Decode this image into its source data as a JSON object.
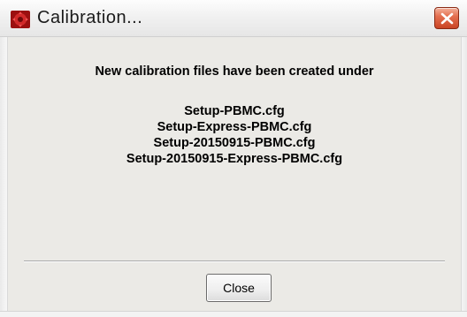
{
  "window": {
    "title": "Calibration...",
    "icon": "red-gear-icon",
    "close_icon": "close-x-icon",
    "accent_close": "#d9583a"
  },
  "dialog": {
    "message": "New calibration files have been created under",
    "files": [
      "Setup-PBMC.cfg",
      "Setup-Express-PBMC.cfg",
      "Setup-20150915-PBMC.cfg",
      "Setup-20150915-Express-PBMC.cfg"
    ],
    "close_button_label": "Close"
  }
}
